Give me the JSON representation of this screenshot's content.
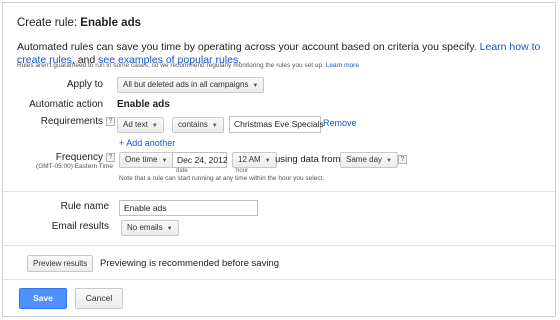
{
  "dialog": {
    "title_prefix": "Create rule: ",
    "title_name": "Enable ads",
    "description": "Automated rules can save you time by operating across your account based on criteria you specify.",
    "learn_link": "Learn how to create rules",
    "desc_mid": ", and",
    "examples_link": "see examples of popular rules",
    "desc_end": ".",
    "note": "Rules aren't guaranteed to run in some cases, so we recommend regularly monitoring the rules you set up.",
    "note_link": "Learn more"
  },
  "apply_to": {
    "label": "Apply to",
    "value": "All but deleted ads in all campaigns"
  },
  "action": {
    "label": "Automatic action",
    "value": "Enable ads"
  },
  "requirements": {
    "label": "Requirements",
    "field": "Ad text",
    "operator": "contains",
    "text": "Christmas Eve Specials",
    "remove": "Remove",
    "add_another": "+ Add another"
  },
  "frequency": {
    "label": "Frequency",
    "timezone": "(GMT-05:00) Eastern Time",
    "freq": "One time",
    "date": "Dec 24, 2012",
    "date_label": "date",
    "hour": "12 AM",
    "hour_label": "hour",
    "using_data": "using data from",
    "data_range": "Same day",
    "note": "Note that a rule can start running at any time within the hour you select."
  },
  "rule_name": {
    "label": "Rule name",
    "value": "Enable ads"
  },
  "email": {
    "label": "Email results",
    "value": "No emails"
  },
  "preview": {
    "button": "Preview results",
    "text": "Previewing is recommended before saving"
  },
  "footer": {
    "save": "Save",
    "cancel": "Cancel"
  },
  "colors": {
    "link": "#1155cc",
    "primary": "#4d90fe"
  }
}
